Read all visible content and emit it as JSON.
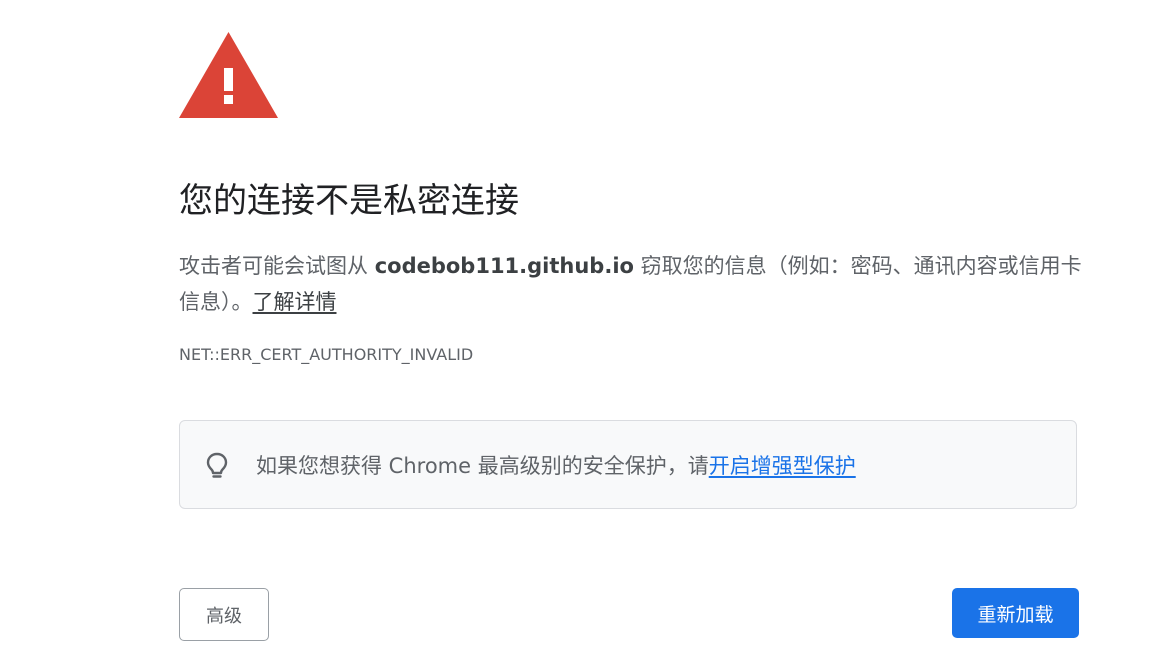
{
  "interstitial": {
    "icon": "warning-triangle-icon",
    "icon_color": "#db4437",
    "title": "您的连接不是私密连接",
    "description": {
      "prefix": "攻击者可能会试图从 ",
      "domain": "codebob111.github.io",
      "suffix": " 窃取您的信息（例如：密码、通讯内容或信用卡信息）。",
      "learn_more": "了解详情"
    },
    "error_code": "NET::ERR_CERT_AUTHORITY_INVALID"
  },
  "tip": {
    "icon": "lightbulb-icon",
    "text": "如果您想获得 Chrome 最高级别的安全保护，请",
    "link": "开启增强型保护",
    "link_color": "#1a73e8"
  },
  "buttons": {
    "advanced": "高级",
    "reload": "重新加载",
    "primary_color": "#1a73e8"
  }
}
